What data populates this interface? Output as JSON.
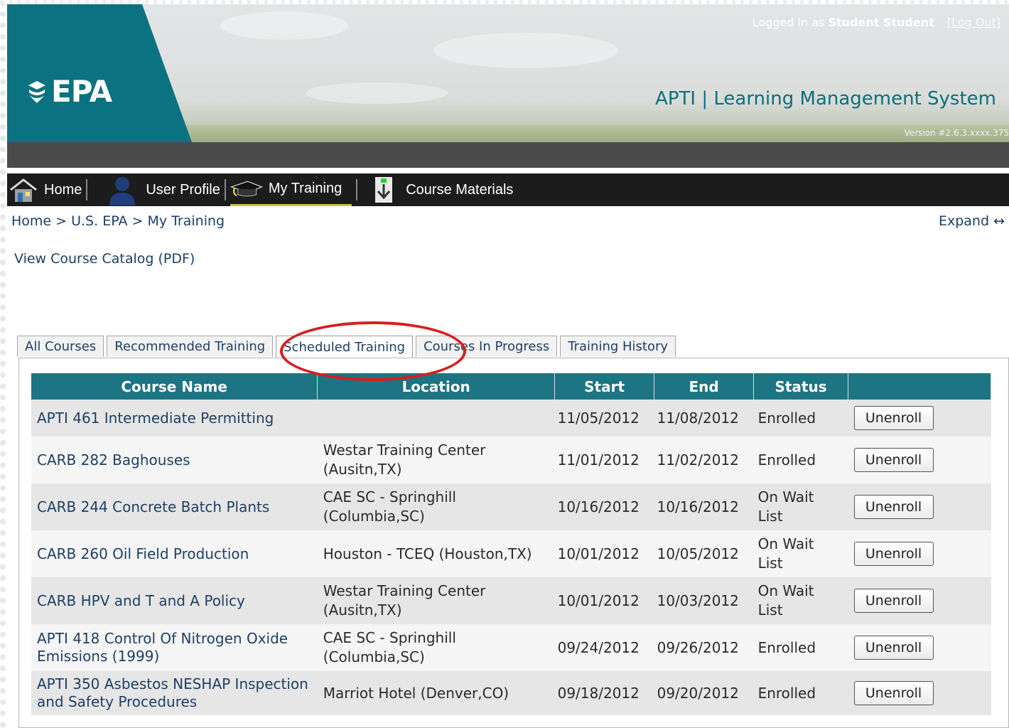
{
  "header": {
    "logo_text": "EPA",
    "login_prefix": "Logged in as ",
    "login_user": "Student Student",
    "logout_label": "[Log Out]",
    "app_title": "APTI | Learning Management System",
    "version": "Version #2.6.3.xxxx.375"
  },
  "nav": {
    "items": [
      {
        "label": "Home",
        "icon": "home-icon"
      },
      {
        "label": "User Profile",
        "icon": "user-icon"
      },
      {
        "label": "My Training",
        "icon": "graduation-cap-icon"
      },
      {
        "label": "Course Materials",
        "icon": "download-icon"
      }
    ],
    "active": "My Training"
  },
  "breadcrumb": "Home > U.S. EPA > My Training",
  "expand_label": "Expand ↔",
  "catalog_link": "View Course Catalog (PDF)",
  "tabs": [
    "All Courses",
    "Recommended Training",
    "Scheduled Training",
    "Courses In Progress",
    "Training History"
  ],
  "active_tab": "Scheduled Training",
  "table": {
    "headers": [
      "Course Name",
      "Location",
      "Start",
      "End",
      "Status",
      ""
    ],
    "rows": [
      {
        "course": "APTI 461 Intermediate Permitting",
        "location": "",
        "start": "11/05/2012",
        "end": "11/08/2012",
        "status": "Enrolled",
        "action": "Unenroll"
      },
      {
        "course": "CARB 282 Baghouses",
        "location": "Westar Training Center (Ausitn,TX)",
        "start": "11/01/2012",
        "end": "11/02/2012",
        "status": "Enrolled",
        "action": "Unenroll"
      },
      {
        "course": "CARB 244 Concrete Batch Plants",
        "location": "CAE SC - Springhill (Columbia,SC)",
        "start": "10/16/2012",
        "end": "10/16/2012",
        "status": "On Wait List",
        "action": "Unenroll"
      },
      {
        "course": "CARB 260 Oil Field Production",
        "location": "Houston - TCEQ (Houston,TX)",
        "start": "10/01/2012",
        "end": "10/05/2012",
        "status": "On Wait List",
        "action": "Unenroll"
      },
      {
        "course": "CARB HPV and T and A Policy",
        "location": "Westar Training Center (Ausitn,TX)",
        "start": "10/01/2012",
        "end": "10/03/2012",
        "status": "On Wait List",
        "action": "Unenroll"
      },
      {
        "course": "APTI 418 Control Of Nitrogen Oxide Emissions (1999)",
        "location": "CAE SC - Springhill (Columbia,SC)",
        "start": "09/24/2012",
        "end": "09/26/2012",
        "status": "Enrolled",
        "action": "Unenroll"
      },
      {
        "course": "APTI 350 Asbestos NESHAP Inspection and Safety Procedures",
        "location": "Marriot Hotel (Denver,CO)",
        "start": "09/18/2012",
        "end": "09/20/2012",
        "status": "Enrolled",
        "action": "Unenroll"
      }
    ]
  },
  "colors": {
    "brand_teal": "#0a7280",
    "table_header": "#1d7482",
    "link_blue": "#1e3f66",
    "highlight_red": "#d61f1f"
  }
}
